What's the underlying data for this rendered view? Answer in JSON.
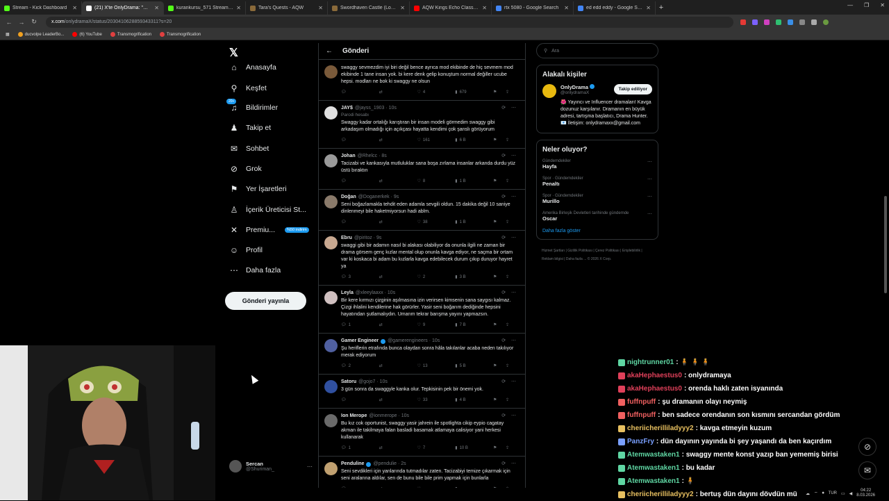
{
  "browser": {
    "tabs": [
      {
        "title": "Stream - Kick Dashboard",
        "color": "#53fc18"
      },
      {
        "title": "(21) X'te OnlyDrama: \"Orenda'...",
        "color": "#ffffff",
        "active": true
      },
      {
        "title": "kurankursu_571 Stream - Watch",
        "color": "#53fc18"
      },
      {
        "title": "Tara's Quests - AQW",
        "color": "#8a6a3a"
      },
      {
        "title": "Swordhaven Castle (Location)",
        "color": "#8a6a3a"
      },
      {
        "title": "AQW Kings Echo Class Full Wal...",
        "color": "#ff0000"
      },
      {
        "title": "rtx 5080 - Google Search",
        "color": "#4285f4"
      },
      {
        "title": "ed edd eddy - Google Search",
        "color": "#4285f4"
      }
    ],
    "url_host": "x.com",
    "url_rest": "/onlydramaX/status/2030410628859343311?s=20",
    "bookmarks": [
      {
        "label": "ducvolpe LeaderBo...",
        "color": "#f0a020"
      },
      {
        "label": "(6) YouTube",
        "color": "#ff0000"
      },
      {
        "label": "Transmogrification",
        "color": "#e04040"
      },
      {
        "label": "Transmogrification",
        "color": "#e04040"
      }
    ]
  },
  "nav": {
    "items": [
      {
        "label": "Anasayfa",
        "icon": "home-icon",
        "glyph": "⌂"
      },
      {
        "label": "Keşfet",
        "icon": "search-icon",
        "glyph": "⚲"
      },
      {
        "label": "Bildirimler",
        "icon": "bell-icon",
        "glyph": "♫",
        "badge": "20+"
      },
      {
        "label": "Takip et",
        "icon": "follow-icon",
        "glyph": "♟"
      },
      {
        "label": "Sohbet",
        "icon": "mail-icon",
        "glyph": "✉"
      },
      {
        "label": "Grok",
        "icon": "grok-icon",
        "glyph": "⊘"
      },
      {
        "label": "Yer İşaretleri",
        "icon": "bookmark-icon",
        "glyph": "⚑"
      },
      {
        "label": "İçerik Üreticisi St...",
        "icon": "creator-icon",
        "glyph": "♙"
      },
      {
        "label": "Premiu...",
        "icon": "x-icon",
        "glyph": "✕",
        "promo": "%50 indirim"
      },
      {
        "label": "Profil",
        "icon": "profile-icon",
        "glyph": "☺"
      },
      {
        "label": "Daha fazla",
        "icon": "more-icon",
        "glyph": "⋯"
      }
    ],
    "post_button": "Gönderi yayınla",
    "profile": {
      "name": "Sercan",
      "handle": "@Shuriman_"
    }
  },
  "main": {
    "back": "←",
    "title": "Gönderi",
    "tweets": [
      {
        "name": "",
        "handle": "",
        "time": "",
        "text": "swaggy sevmezdim iyi biri değil bence ayrıca mod ekibinde de hiç sevmem mod ekibinde 1 tane insan yok. bi kere denk gelip konuştum normal değiller ucube hepsi. modları ne bok ki swaggy ne olsun",
        "replies": "",
        "rts": "",
        "likes": "4",
        "views": "679",
        "avatar": "#7a5a3a"
      },
      {
        "name": "JAY$",
        "handle": "@jayss_1903 · 10s",
        "sub": "Parodi hesabı",
        "text": "Swaggy kadar ortalığı karıştıran bir insan modeli görmedim swaggy gibi arkadaşım olmadığı için açıkçası hayatta kendimi çok şanslı görüyorum",
        "replies": "",
        "rts": "",
        "likes": "161",
        "views": "6 B",
        "avatar": "#e0e0e0"
      },
      {
        "name": "Johan",
        "handle": "@Rhelcc · 8s",
        "text": "Tacizabi ve kankasıyla  mutluluklar sana boşa zırlama insanlar arkanda durdu yüz üstü bıraktın",
        "replies": "",
        "rts": "",
        "likes": "8",
        "views": "1 B",
        "avatar": "#9a9a9a"
      },
      {
        "name": "Doğan",
        "handle": "@Doganerkek · 9s",
        "text": "Seni boğazlamakla tehdit eden adamla sevgili oldun. 15 dakika değil 10 saniye dinlenmeyi bile haketmiyorsun hadi ablm.",
        "replies": "",
        "rts": "",
        "likes": "38",
        "views": "1 B",
        "avatar": "#8a7a6a"
      },
      {
        "name": "Ebru",
        "handle": "@piritoz · 9s",
        "text": "swaggi gibi bir adamın nasıl bi alakası olabiliyor da onunla ilgili ne zaman bir drama görsem genç kızlar mental olup onunla kavga ediyor, ne saçma bir ortam var ki koskaca bi adam bu kızlarla kavga edebilecek durum çıkıp duruyor hayret ya",
        "replies": "3",
        "rts": "",
        "likes": "2",
        "views": "3 B",
        "avatar": "#c8a890"
      },
      {
        "name": "Leyla",
        "handle": "@xleeylaaxx · 10s",
        "text": "Bir kere kırmızı çizginin aşılmasına izin verirsen kimsenin sana saygısı kalmaz. Çizgi ihlalini kendilerine hak görürler. Yasir seni boğarım dediğinde hepsini hayatından şutlamalıydın. Umarım tekrar barışma yayını yapmazsın.",
        "replies": "1",
        "rts": "",
        "likes": "9",
        "views": "7 B",
        "avatar": "#d0c0c0"
      },
      {
        "name": "Gamer Engineer",
        "handle": "@gamerengineers · 10s",
        "verified": true,
        "text": "Şu heriflerin etrafında bunca olaydan sonra hâla takılanlar acaba neden takılıyor merak ediyorum",
        "replies": "2",
        "rts": "",
        "likes": "13",
        "views": "5 B",
        "avatar": "#5060a0"
      },
      {
        "name": "Satoru",
        "handle": "@gojo7 · 10s",
        "text": "3 gün sonra da swaggyle kanka olur. Tepkisinin pek bir önemi yok.",
        "replies": "",
        "rts": "",
        "likes": "33",
        "views": "4 B",
        "avatar": "#3050a0"
      },
      {
        "name": "Ion Merope",
        "handle": "@ionmerope · 10s",
        "text": "Bu kız cok oportunist, swaggy yasir jahrein ile spotlighta cikip eypio cagatay akman ile takilmaya falan basladi basamak atlamaya calisiyor yani herkesi kullanarak",
        "replies": "1",
        "rts": "",
        "likes": "7",
        "views": "10 B",
        "avatar": "#6a6a6a"
      },
      {
        "name": "Penduline",
        "handle": "@pendulie · 2s",
        "verified": true,
        "text": "Seni sevdikleri için yanlarında tutmadılar zaten. Tacizabiyi temize çıkarmak için seni aralarına aldılar, sen de bunu bile bile prim yapmak için bunlarla",
        "replies": "",
        "rts": "",
        "likes": "",
        "views": "",
        "avatar": "#c0a070"
      }
    ]
  },
  "right": {
    "search_placeholder": "Ara",
    "people_title": "Alakalı kişiler",
    "person": {
      "name": "OnlyDrama",
      "handle": "@onlydramaX",
      "follow": "Takip ediliyor",
      "bio": "🌺 Yayıncı ve Influencer dramaları! Kavga dozunuz karşılanır. Dramanın en büyük adresi, tartışma başlatıcı, Drama Hunter. 📧 İletişim: onlydramaxx@gmail.com"
    },
    "trends_title": "Neler oluyor?",
    "trends": [
      {
        "category": "Gündemdekiler",
        "title": "Hayfa"
      },
      {
        "category": "Spor · Gündemdekiler",
        "title": "Penaltı"
      },
      {
        "category": "Spor · Gündemdekiler",
        "title": "Murillo"
      },
      {
        "category": "Amerika Birleşik Devletleri tarihinde gündemde",
        "title": "Oscar"
      }
    ],
    "show_more": "Daha fazla göster",
    "footer": "Hizmet Şartları | Gizlilik Politikası | Çerez Politikası | Erişilebilirlik | Reklam bilgisi | Daha fazla ... © 2026 X Corp."
  },
  "chat": [
    {
      "user": "nightrunner01",
      "msg": ": 🧍 🧍 🧍",
      "color": "#5fd6a3"
    },
    {
      "user": "akaHephaestus0",
      "msg": ": onlydramaya",
      "color": "#e0405a"
    },
    {
      "user": "akaHephaestus0",
      "msg": ": orenda haklı zaten isyanında",
      "color": "#e0405a"
    },
    {
      "user": "fuffnpuff",
      "msg": ": şu dramanın olayı neymiş",
      "color": "#f06060"
    },
    {
      "user": "fuffnpuff",
      "msg": ": ben sadece orendanın son kısmını sercandan gördüm",
      "color": "#f06060"
    },
    {
      "user": "cheriicherilliladyyy2",
      "msg": ": kavga etmeyin kuzum",
      "color": "#e8c060"
    },
    {
      "user": "PanzFry",
      "msg": ": dün dayının yayında bi şey yaşandı da ben kaçırdım",
      "color": "#7aa0ff"
    },
    {
      "user": "Atemwastaken1",
      "msg": ": swaggy mente konst yazıp ban yememiş birisi",
      "color": "#5fd6a3"
    },
    {
      "user": "Atemwastaken1",
      "msg": ": bu kadar",
      "color": "#5fd6a3"
    },
    {
      "user": "Atemwastaken1",
      "msg": ": 🧍",
      "color": "#5fd6a3"
    },
    {
      "user": "cheriicherilliladyyy2",
      "msg": ": bertuş dün dayını dövdün mü",
      "color": "#e8c060"
    }
  ],
  "taskbar": {
    "lang": "TUR",
    "time": "04:22",
    "date": "8.03.2026"
  }
}
